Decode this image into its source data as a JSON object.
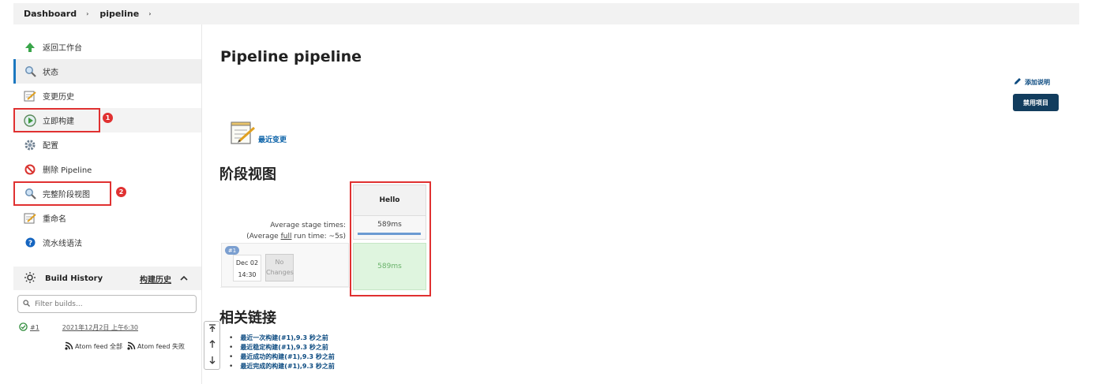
{
  "breadcrumb": {
    "items": [
      "Dashboard",
      "pipeline"
    ],
    "sep": "›"
  },
  "sidebar": {
    "items": [
      {
        "label": "返回工作台",
        "icon": "up-arrow-icon"
      },
      {
        "label": "状态",
        "icon": "search-icon"
      },
      {
        "label": "变更历史",
        "icon": "notepad-icon"
      },
      {
        "label": "立即构建",
        "icon": "build-now-icon"
      },
      {
        "label": "配置",
        "icon": "gear-icon"
      },
      {
        "label": "删除 Pipeline",
        "icon": "no-entry-icon"
      },
      {
        "label": "完整阶段视图",
        "icon": "search-icon"
      },
      {
        "label": "重命名",
        "icon": "notepad-icon"
      },
      {
        "label": "流水线语法",
        "icon": "help-icon"
      }
    ],
    "annotations": [
      "1",
      "2"
    ]
  },
  "build_history": {
    "title": "Build History",
    "link": "构建历史",
    "caret": "^",
    "filter_placeholder": "Filter builds...",
    "builds": [
      {
        "number": "#1",
        "date": "2021年12月2日 上午6:30",
        "status": "success"
      }
    ],
    "feeds": [
      "Atom feed 全部",
      "Atom feed 失败"
    ]
  },
  "main": {
    "title": "Pipeline pipeline",
    "add_description": "添加说明",
    "disable_button": "禁用项目",
    "recent_changes": "最近变更",
    "stage_view_title": "阶段视图",
    "related_links_title": "相关链接"
  },
  "stage_view": {
    "avg_label_line1": "Average stage times:",
    "avg_label_line2_prefix": "(Average ",
    "avg_label_full": "full",
    "avg_label_line2_suffix": " run time: ~5s)",
    "stage_name": "Hello",
    "stage_avg": "589ms",
    "run": {
      "badge": "#1",
      "date": "Dec 02",
      "time": "14:30",
      "no_changes_1": "No",
      "no_changes_2": "Changes",
      "duration": "589ms"
    }
  },
  "related_links": [
    "最近一次构建(#1),9.3 秒之前",
    "最近稳定构建(#1),9.3 秒之前",
    "最近成功的构建(#1),9.3 秒之前",
    "最近完成的构建(#1),9.3 秒之前"
  ],
  "colors": {
    "annotation": "#e03131",
    "primary": "#123d5e",
    "success": "#dff5df",
    "link": "#0b4a80"
  }
}
